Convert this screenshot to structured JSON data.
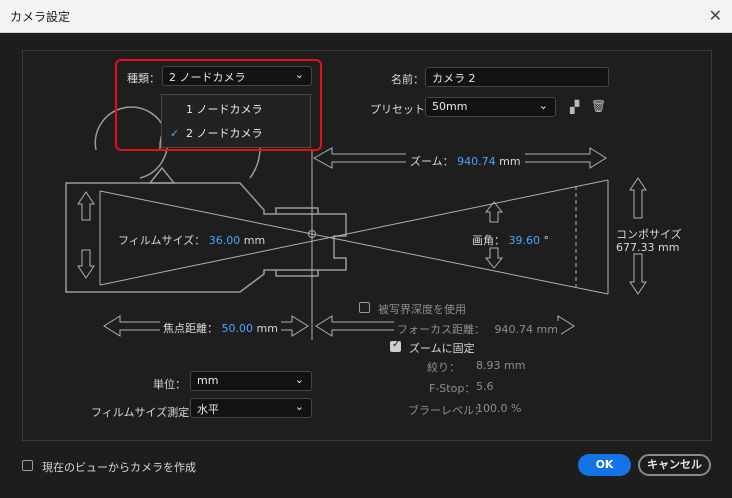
{
  "window": {
    "title": "カメラ設定"
  },
  "camera_type": {
    "label": "種類：",
    "selected": "2 ノードカメラ",
    "options": [
      "1 ノードカメラ",
      "2 ノードカメラ"
    ]
  },
  "name": {
    "label": "名前：",
    "value": "カメラ 2"
  },
  "preset": {
    "label": "プリセット：",
    "value": "50mm"
  },
  "diagram": {
    "zoom_label": "ズーム：",
    "zoom_value": "940.74",
    "zoom_unit": "mm",
    "film_size_label": "フィルムサイズ：",
    "film_size_value": "36.00",
    "film_size_unit": "mm",
    "angle_label": "画角：",
    "angle_value": "39.60",
    "angle_unit": "°",
    "comp_size_label": "コンポサイズ",
    "comp_size_value": "677.33 mm",
    "focal_length_label": "焦点距離：",
    "focal_length_value": "50.00",
    "focal_length_unit": "mm"
  },
  "depth_of_field": {
    "label": "被写界深度を使用",
    "checked": false
  },
  "focus_distance": {
    "label": "フォーカス距離：",
    "value": "940.74 mm"
  },
  "lock_zoom": {
    "label": "ズームに固定",
    "checked": true
  },
  "aperture": {
    "label": "絞り：",
    "value": "8.93 mm"
  },
  "fstop": {
    "label": "F-Stop：",
    "value": "5.6"
  },
  "blur_level": {
    "label": "ブラーレベル：",
    "value": "100.0 %"
  },
  "units": {
    "label": "単位：",
    "value": "mm"
  },
  "measure_film_size": {
    "label": "フィルムサイズ測定：",
    "value": "水平"
  },
  "create_from_view": {
    "label": "現在のビューからカメラを作成",
    "checked": false
  },
  "buttons": {
    "ok": "OK",
    "cancel": "キャンセル"
  }
}
